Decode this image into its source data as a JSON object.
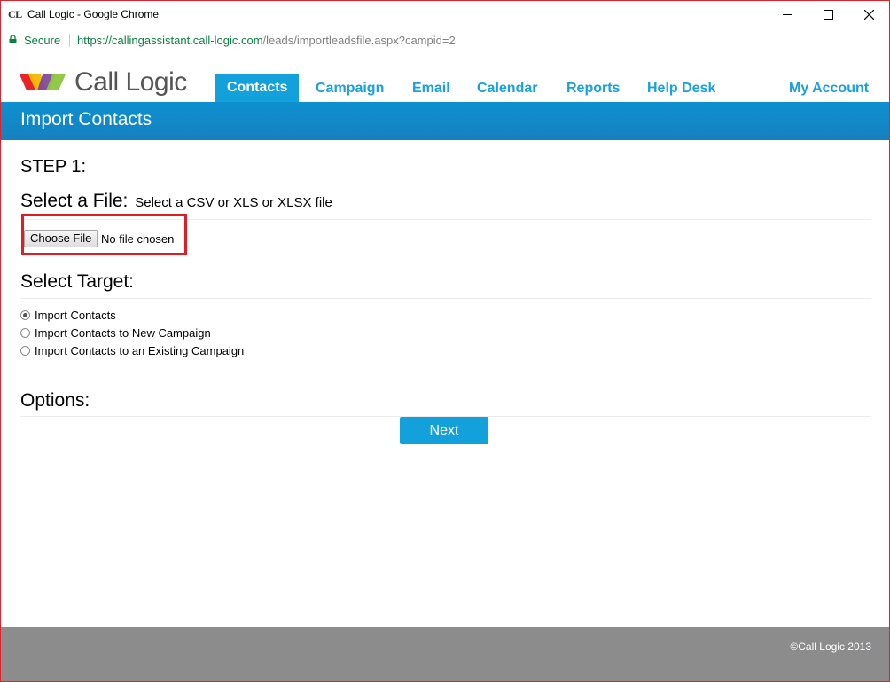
{
  "window": {
    "favicon_text": "CL",
    "title": "Call Logic - Google Chrome"
  },
  "addressbar": {
    "secure_label": "Secure",
    "url_host": "https://callingassistant.call-logic.com",
    "url_path": "/leads/importleadsfile.aspx?campid=2"
  },
  "header": {
    "logo_text": "Call Logic",
    "nav": [
      {
        "label": "Contacts",
        "active": true
      },
      {
        "label": "Campaign",
        "active": false
      },
      {
        "label": "Email",
        "active": false
      },
      {
        "label": "Calendar",
        "active": false
      },
      {
        "label": "Reports",
        "active": false
      },
      {
        "label": "Help Desk",
        "active": false
      }
    ],
    "my_account": "My Account"
  },
  "banner": {
    "title": "Import Contacts"
  },
  "main": {
    "step_title": "STEP 1:",
    "select_file": {
      "heading": "Select a File:",
      "hint": "Select a CSV or XLS or XLSX file",
      "button_label": "Choose File",
      "file_status": "No file chosen"
    },
    "select_target": {
      "heading": "Select Target:",
      "options": [
        {
          "label": "Import Contacts",
          "checked": true
        },
        {
          "label": "Import Contacts to New Campaign",
          "checked": false
        },
        {
          "label": "Import Contacts to an Existing Campaign",
          "checked": false
        }
      ]
    },
    "options_heading": "Options:",
    "next_label": "Next"
  },
  "footer": {
    "copyright": "©Call Logic 2013"
  },
  "colors": {
    "accent": "#13a1dc",
    "banner": "#1581bf",
    "highlight_border": "#e01c24",
    "footer": "#8c8c8c"
  }
}
